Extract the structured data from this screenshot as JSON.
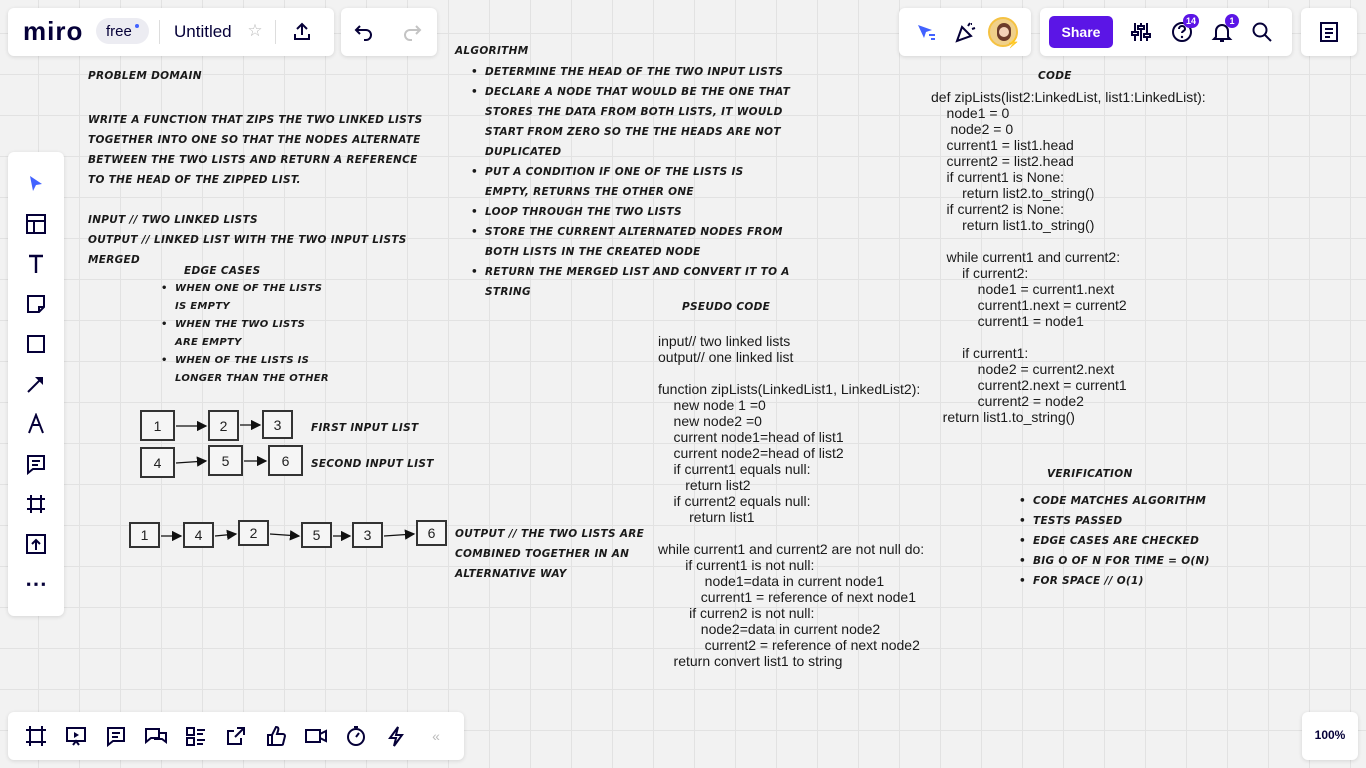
{
  "topbar": {
    "logo": "miro",
    "plan_badge": "free",
    "board_title": "Untitled",
    "share_label": "Share",
    "help_badge": "14",
    "notif_badge": "1",
    "accent": "#4262ff",
    "share_color": "#5b15e6"
  },
  "zoom": "100%",
  "problem": {
    "title": "Problem Domain",
    "description": "Write a function that zips the two linked lists together into one so that the nodes alternate between the two lists and return a reference to the head of the zipped list.",
    "input": "Input // two linked lists",
    "output": "Output // linked list with the two input lists merged"
  },
  "edge_cases": {
    "title": "Edge Cases",
    "items": [
      "When one of the lists is empty",
      "When the two lists are empty",
      "When of the lists is longer than the other"
    ]
  },
  "diagram": {
    "list1": [
      "1",
      "2",
      "3"
    ],
    "list1_label": "First input list",
    "list2": [
      "4",
      "5",
      "6"
    ],
    "list2_label": "Second input list",
    "output": [
      "1",
      "4",
      "2",
      "5",
      "3",
      "6"
    ],
    "output_label": "Output // the two lists are combined together in an alternative way"
  },
  "algorithm": {
    "title": "Algorithm",
    "items": [
      "Determine the head of the two input lists",
      "Declare a node that would be the one that stores the data from both lists, it would start from zero so the the heads are not duplicated",
      "Put a condition  if one of the lists is empty, returns the other one",
      "Loop through the two lists",
      "Store the current alternated nodes from both lists in the created node",
      "Return the merged list and convert it to a string"
    ]
  },
  "pseudo": {
    "title": "Pseudo Code",
    "lines": [
      "input// two linked lists",
      "output// one linked list",
      "",
      "function zipLists(LinkedList1, LinkedList2):",
      "    new node 1 =0",
      "    new node2 =0",
      "    current node1=head of list1",
      "    current node2=head of list2",
      "    if current1 equals null:",
      "       return list2",
      "    if current2 equals null:",
      "        return list1",
      "",
      "while current1 and current2 are not null do:",
      "       if current1 is not null:",
      "            node1=data in current node1",
      "           current1 = reference of next node1",
      "        if curren2 is not null:",
      "           node2=data in current node2",
      "            current2 = reference of next node2",
      "    return convert list1 to string"
    ]
  },
  "code": {
    "title": "Code",
    "lines": [
      "def zipLists(list2:LinkedList, list1:LinkedList):",
      "    node1 = 0",
      "     node2 = 0",
      "    current1 = list1.head",
      "    current2 = list2.head",
      "    if current1 is None:",
      "        return list2.to_string()",
      "    if current2 is None:",
      "        return list1.to_string()",
      "",
      "    while current1 and current2:",
      "        if current2:",
      "            node1 = current1.next",
      "            current1.next = current2",
      "            current1 = node1",
      "",
      "        if current1:",
      "            node2 = current2.next",
      "            current2.next = current1",
      "            current2 = node2",
      "   return list1.to_string()"
    ]
  },
  "verification": {
    "title": "Verification",
    "items": [
      "Code matches algorithm",
      "Tests passed",
      "Edge cases are checked",
      "Big O of n for time = O(n)",
      "For space // O(1)"
    ]
  }
}
